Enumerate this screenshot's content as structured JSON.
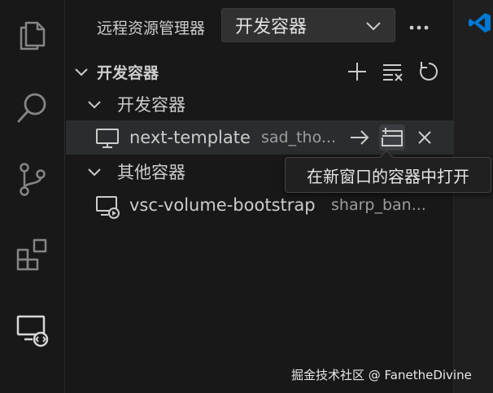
{
  "panel": {
    "title": "远程资源管理器",
    "target_selected": "开发容器",
    "more_icon": "ellipsis-icon"
  },
  "section": {
    "title": "开发容器",
    "actions": [
      "add-icon",
      "clear-all-icon",
      "refresh-icon"
    ]
  },
  "groups": [
    {
      "label": "开发容器",
      "items": [
        {
          "name": "next-template",
          "description": "sad_tho...",
          "icon": "monitor-icon",
          "actions": [
            "arrow-right-icon",
            "open-in-new-window-icon",
            "close-icon"
          ]
        }
      ]
    },
    {
      "label": "其他容器",
      "items": [
        {
          "name": "vsc-volume-bootstrap",
          "description": "sharp_ban...",
          "icon": "monitor-play-icon"
        }
      ]
    }
  ],
  "tooltip": {
    "text": "在新窗口的容器中打开"
  },
  "activity_bar": [
    "explorer-icon",
    "search-icon",
    "source-control-icon",
    "extensions-icon",
    "remote-explorer-icon"
  ],
  "watermark": "掘金技术社区 @ FanetheDivine",
  "colors": {
    "background": "#181818",
    "selection": "#2a2d2e",
    "brand_blue": "#0078d4"
  }
}
